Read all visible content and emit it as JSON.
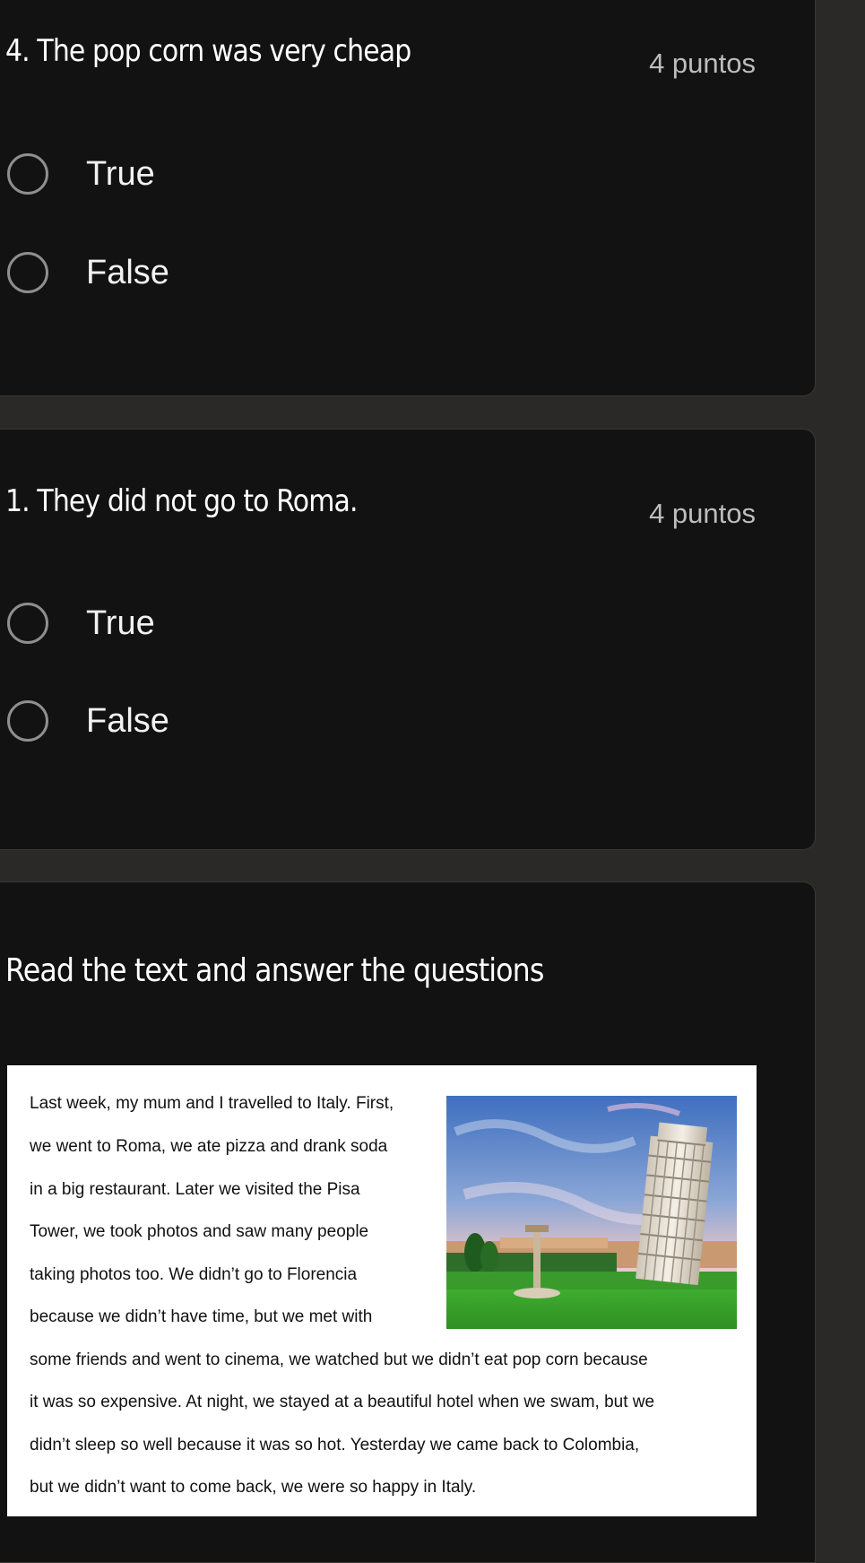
{
  "question_4": {
    "title": "4. The pop corn was very cheap",
    "points": "4 puntos",
    "options": [
      "True",
      "False"
    ]
  },
  "question_1": {
    "title": "1. They did not go to Roma.",
    "points": "4 puntos",
    "options": [
      "True",
      "False"
    ]
  },
  "reading": {
    "title": "Read the text and answer the questions",
    "passage_lines": [
      "Last week, my mum and I travelled to Italy. First,",
      "we went to Roma, we ate pizza and drank soda",
      "in a big restaurant. Later we visited the Pisa",
      "Tower, we took photos and saw many people",
      "taking photos too. We didn’t go to Florencia",
      "because we didn’t have time, but we met with",
      "some friends and went to cinema, we watched but we didn’t eat pop corn because",
      "it was so expensive. At night, we stayed at a beautiful hotel when we swam, but we",
      "didn’t sleep so well because it was so hot. Yesterday we came back to Colombia,",
      "but we didn’t want to come back, we were so happy in Italy."
    ]
  },
  "colors": {
    "page_background": "#2b2927",
    "card_background": "#121212",
    "text_primary": "#ffffff",
    "text_secondary": "#bdbdbd",
    "radio_border": "#8f8f8f"
  }
}
